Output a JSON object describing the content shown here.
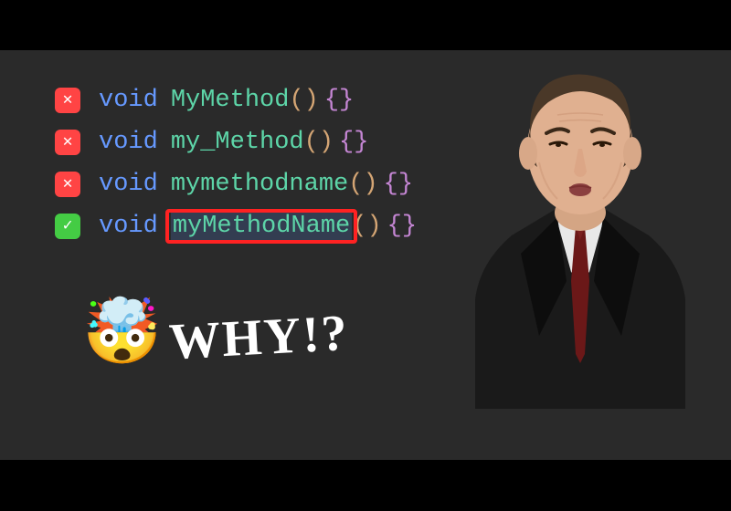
{
  "code": {
    "keyword": "void",
    "lines": [
      {
        "status": "wrong",
        "method": "MyMethod",
        "highlighted": false
      },
      {
        "status": "wrong",
        "method": "my_Method",
        "highlighted": false
      },
      {
        "status": "wrong",
        "method": "mymethodname",
        "highlighted": false
      },
      {
        "status": "correct",
        "method": "myMethodName",
        "highlighted": true
      }
    ],
    "parens": "()",
    "braces": "{}"
  },
  "caption": {
    "emoji": "🤯",
    "text": "WHY!?"
  },
  "icons": {
    "cross": "✕",
    "check": "✓"
  },
  "colors": {
    "bg": "#2a2a2a",
    "void": "#6699ff",
    "method": "#5dd5a8",
    "parens": "#d4a574",
    "braces": "#c586d4",
    "cross_bg": "#ff4444",
    "check_bg": "#44cc44",
    "highlight_border": "#ff2222"
  }
}
